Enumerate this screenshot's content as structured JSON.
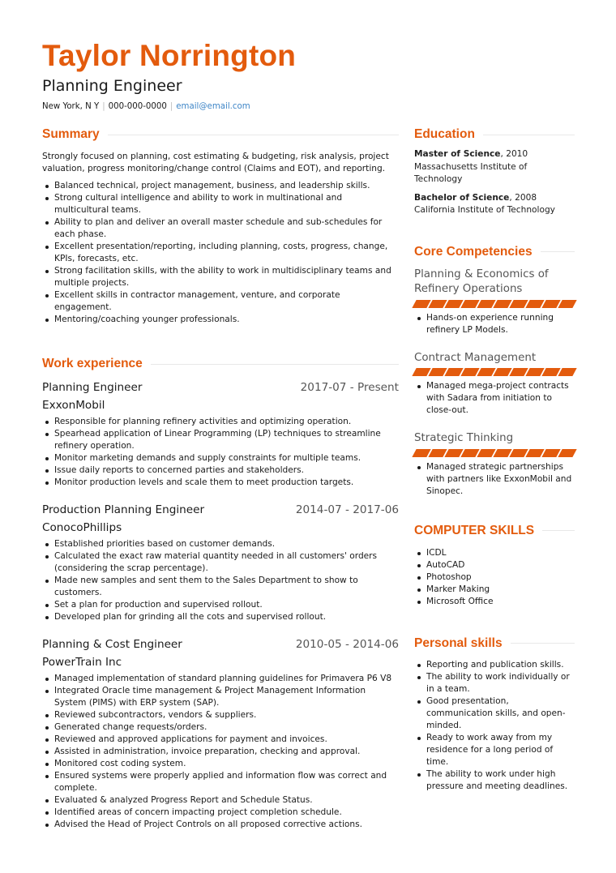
{
  "header": {
    "name": "Taylor Norrington",
    "title": "Planning Engineer",
    "location": "New York, N Y",
    "phone": "000-000-0000",
    "email": "email@email.com",
    "separator": "|"
  },
  "colors": {
    "accent": "#e35b0d",
    "link": "#3f86c7",
    "rule": "#e8e8e8",
    "muted_text": "#555555"
  },
  "summary": {
    "heading": "Summary",
    "paragraph": "Strongly focused on planning, cost estimating & budgeting, risk analysis, project valuation, progress monitoring/change control (Claims and EOT), and reporting.",
    "bullets": [
      "Balanced technical, project management, business, and leadership skills.",
      "Strong cultural intelligence and ability  to work in multinational and multicultural teams.",
      "Ability to plan and deliver an overall master schedule and sub-schedules for each phase.",
      "Excellent presentation/reporting, including planning, costs, progress, change, KPIs, forecasts, etc.",
      "Strong facilitation skills, with the ability to work in multidisciplinary teams and multiple projects.",
      "Excellent skills in contractor management, venture, and corporate engagement.",
      "Mentoring/coaching younger professionals."
    ]
  },
  "work": {
    "heading": "Work experience",
    "jobs": [
      {
        "title": "Planning Engineer",
        "dates": "2017-07 - Present",
        "company": "ExxonMobil",
        "bullets": [
          "Responsible for planning refinery activities and optimizing operation.",
          "Spearhead application of Linear Programming (LP) techniques to streamline refinery operation.",
          "Monitor marketing demands and supply constraints for multiple teams.",
          "Issue daily reports to concerned parties and stakeholders.",
          "Monitor production levels and scale them to meet production targets."
        ]
      },
      {
        "title": "Production Planning Engineer",
        "dates": "2014-07 - 2017-06",
        "company": "ConocoPhillips",
        "bullets": [
          "Established priorities based on customer demands.",
          "Calculated the exact raw material quantity needed in all customers' orders (considering the scrap percentage).",
          "Made new samples and sent them to the Sales Department to show to customers.",
          "Set a plan for production and supervised rollout.",
          "Developed plan for grinding all the cots and supervised rollout."
        ]
      },
      {
        "title": "Planning & Cost Engineer",
        "dates": "2010-05 - 2014-06",
        "company": "PowerTrain Inc",
        "bullets": [
          "Managed implementation of standard planning guidelines for Primavera P6 V8",
          "Integrated Oracle time management & Project Management Information System (PIMS) with ERP system (SAP).",
          "Reviewed subcontractors, vendors & suppliers.",
          "Generated change requests/orders.",
          "Reviewed and approved applications for payment and invoices.",
          "Assisted in administration, invoice preparation, checking and approval.",
          "Monitored cost coding system.",
          "Ensured systems were properly applied and information flow was correct and complete.",
          "Evaluated & analyzed Progress Report and Schedule Status.",
          "Identified areas of concern impacting project completion schedule.",
          "Advised the Head of Project Controls on all proposed corrective actions."
        ]
      }
    ]
  },
  "education": {
    "heading": "Education",
    "items": [
      {
        "degree": "Master of Science",
        "year": ", 2010",
        "school": "Massachusetts Institute of Technology"
      },
      {
        "degree": "Bachelor of Science",
        "year": ", 2008",
        "school": "California Institute of Technology"
      }
    ]
  },
  "competencies": {
    "heading": "Core Competencies",
    "items": [
      {
        "name": "Planning & Economics of Refinery Operations",
        "level": 10,
        "max": 10,
        "bullets": [
          "Hands-on experience running refinery LP Models."
        ]
      },
      {
        "name": "Contract Management",
        "level": 10,
        "max": 10,
        "bullets": [
          "Managed mega-project contracts with Sadara from initiation to close-out."
        ]
      },
      {
        "name": "Strategic Thinking",
        "level": 10,
        "max": 10,
        "bullets": [
          "Managed strategic partnerships with partners like ExxonMobil and Sinopec."
        ]
      }
    ]
  },
  "computer_skills": {
    "heading": "COMPUTER SKILLS",
    "items": [
      "ICDL",
      "AutoCAD",
      "Photoshop",
      "Marker Making",
      "Microsoft Office"
    ]
  },
  "personal_skills": {
    "heading": "Personal skills",
    "items": [
      "Reporting and publication skills.",
      "The ability to work individually or in a team.",
      "Good presentation, communication skills, and open- minded.",
      "Ready to work away from my residence for a long period of time.",
      "The ability to work under high pressure and meeting deadlines."
    ]
  }
}
